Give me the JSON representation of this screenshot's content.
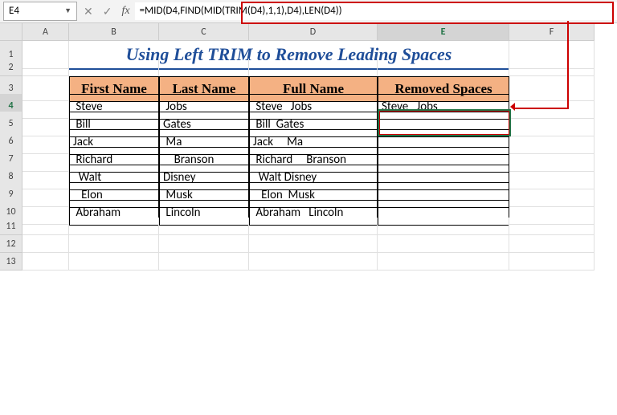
{
  "name_box": "E4",
  "formula": "=MID(D4,FIND(MID(TRIM(D4),1,1),D4),LEN(D4))",
  "columns": [
    "A",
    "B",
    "C",
    "D",
    "E",
    "F"
  ],
  "rows": [
    "1",
    "2",
    "3",
    "4",
    "5",
    "6",
    "7",
    "8",
    "9",
    "10",
    "11",
    "12",
    "13"
  ],
  "title": "Using Left TRIM to Remove Leading Spaces",
  "headers": {
    "first": "First Name",
    "last": "Last Name",
    "full": "Full Name",
    "removed": "Removed Spaces"
  },
  "data": [
    {
      "first": " Steve",
      "last": " Jobs",
      "full": " Steve   Jobs",
      "removed": "Steve   Jobs"
    },
    {
      "first": " Bill",
      "last": "Gates",
      "full": " Bill  Gates",
      "removed": ""
    },
    {
      "first": "Jack",
      "last": " Ma",
      "full": "Jack     Ma",
      "removed": ""
    },
    {
      "first": " Richard",
      "last": "    Branson",
      "full": " Richard     Branson",
      "removed": ""
    },
    {
      "first": "  Walt",
      "last": "Disney",
      "full": "  Walt Disney",
      "removed": ""
    },
    {
      "first": "   Elon",
      "last": " Musk",
      "full": "   Elon  Musk",
      "removed": ""
    },
    {
      "first": " Abraham",
      "last": " Lincoln",
      "full": " Abraham   Lincoln",
      "removed": ""
    }
  ]
}
